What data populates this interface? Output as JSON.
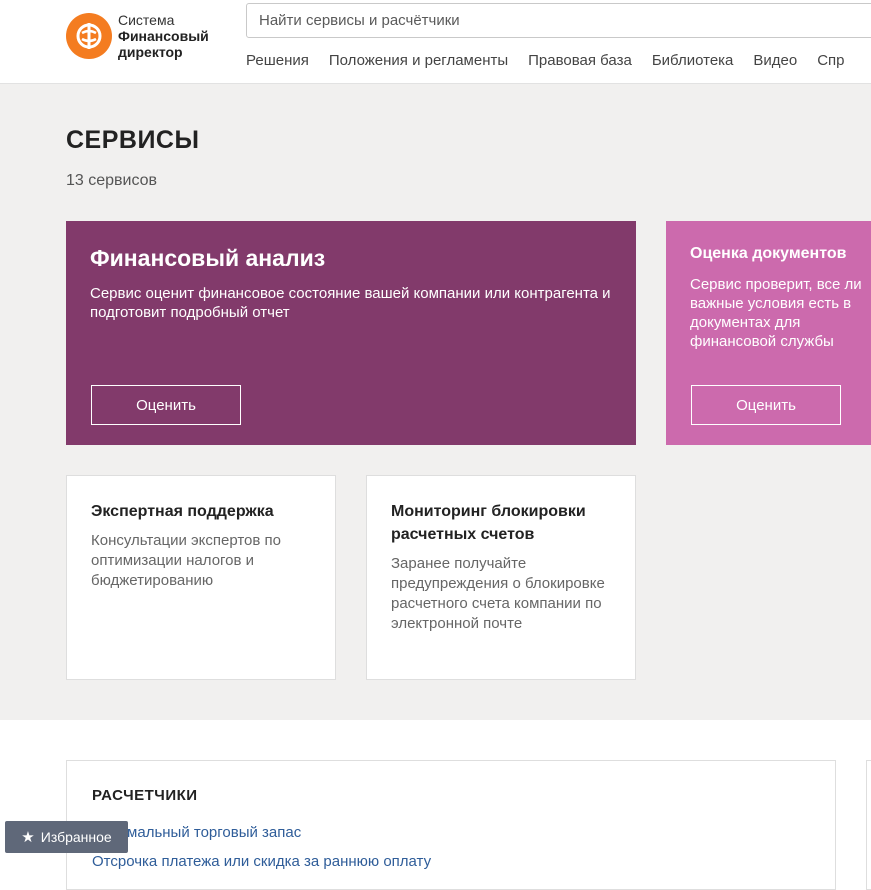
{
  "header": {
    "logo": {
      "line1": "Система",
      "line2": "Финансовый",
      "line3": "директор"
    },
    "search_placeholder": "Найти сервисы и расчётчики",
    "nav": [
      "Решения",
      "Положения и регламенты",
      "Правовая база",
      "Библиотека",
      "Видео",
      "Спр"
    ]
  },
  "page": {
    "title": "СЕРВИСЫ",
    "count": "13 сервисов"
  },
  "featured": [
    {
      "title": "Финансовый анализ",
      "description": "Сервис оценит финансовое состояние вашей компании или контрагента и подготовит подробный отчет",
      "button": "Оценить",
      "color": "#823a6b"
    },
    {
      "title": "Оценка документов",
      "description": "Сервис проверит, все ли важные условия есть в документах для финансовой службы",
      "button": "Оценить",
      "color": "#cc6aad"
    }
  ],
  "services": [
    {
      "title": "Экспертная поддержка",
      "description": "Консультации экспертов по оптимизации налогов и бюджетированию"
    },
    {
      "title": "Мониторинг блокировки расчетных счетов",
      "description": "Заранее получайте предупреждения о блокировке расчетного счета компании по электронной почте"
    }
  ],
  "calculators": {
    "title": "РАСЧЕТЧИКИ",
    "links": [
      "Оптимальный торговый запас",
      "Отсрочка платежа или скидка за раннюю оплату"
    ]
  },
  "favorites": {
    "label": "Избранное"
  },
  "colors": {
    "accent": "#f47c20",
    "link": "#2f5d99",
    "background": "#f1f0ef"
  }
}
